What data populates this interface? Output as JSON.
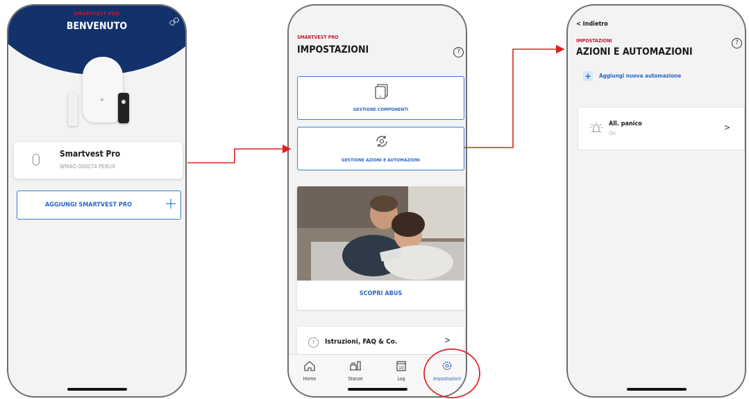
{
  "screen1": {
    "brand": "SMARTVEST PRO",
    "title": "BENVENUTO",
    "device": {
      "name": "Smartvest Pro",
      "id": "WMAG-000074-PEKUX"
    },
    "add_label": "AGGIUNGI SMARTVEST PRO",
    "icons": [
      "gears-icon",
      "hub-icon",
      "plus-icon"
    ]
  },
  "screen2": {
    "brand": "SMARTVEST PRO",
    "title": "IMPOSTAZIONI",
    "help": "?",
    "cards": [
      {
        "label": "GESTIONE COMPONENTI",
        "icon": "tablet-icon"
      },
      {
        "label": "GESTIONE AZIONI E AUTOMAZIONI",
        "icon": "automation-icon"
      }
    ],
    "promo_label": "SCOPRI ABUS",
    "faq_label": "Istruzioni, FAQ & Co.",
    "faq_icon": "?",
    "chevron": ">",
    "calendar_day": "10",
    "tabs": [
      {
        "label": "Home",
        "icon": "home-icon"
      },
      {
        "label": "Stanze",
        "icon": "rooms-icon"
      },
      {
        "label": "Log",
        "icon": "calendar-icon"
      },
      {
        "label": "Impostazioni",
        "icon": "gear-icon",
        "active": true
      }
    ]
  },
  "screen3": {
    "back": "< Indietro",
    "brand": "IMPOSTAZIONI",
    "title": "AZIONI E AUTOMAZIONI",
    "help": "?",
    "add_plus": "+",
    "add_label": "Aggiungi nuova automazione",
    "automation": {
      "name": "All. panico",
      "status": "On"
    },
    "chevron": ">"
  },
  "colors": {
    "accent": "#2a66c4",
    "brand_red": "#c4182c",
    "header_navy": "#13326c",
    "annotation_red": "#e02020"
  }
}
